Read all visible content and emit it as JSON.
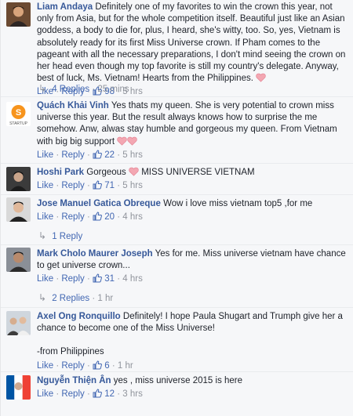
{
  "common": {
    "like": "Like",
    "reply": "Reply",
    "dot": "·"
  },
  "comments": [
    {
      "author": "Liam Andaya",
      "text": "Definitely one of my favorites to win the crown this year, not only from Asia, but for the whole competition itself. Beautiful just like an Asian goddess, a body to die for, plus, I heard, she's witty, too. So, yes, Vietnam is absolutely ready for its first Miss Universe crown. If Pham comes to the pageant with all the necessary preparations, I don't mind seeing the crown on her head even though my top favorite is still my country's delegate. Anyway, best of luck, Ms. Vietnam! Hearts from the Philippines.",
      "likes": "98",
      "time": "5 hrs",
      "replies": "4 Replies",
      "replies_time": "25 mins"
    },
    {
      "author": "Quách Khải Vinh",
      "text": "Yes thats my queen. She is very potential to crown miss universe this year. But the result always knows how to surprise the me somehow. Anw, alwas stay humble and gorgeous my queen. From Vietnam with big big support",
      "likes": "22",
      "time": "5 hrs",
      "avatar_label": "STARTUP"
    },
    {
      "author": "Hoshi Park",
      "text_before": "Gorgeous",
      "text_after": "MISS UNIVERSE VIETNAM",
      "likes": "71",
      "time": "5 hrs"
    },
    {
      "author": "Jose Manuel Gatica Obreque",
      "text": "Wow i love miss vietnam top5 ,for me",
      "likes": "20",
      "time": "4 hrs",
      "replies": "1 Reply"
    },
    {
      "author": "Mark Cholo Maurer Joseph",
      "text": "Yes for me. Miss universe vietnam have chance to get universe crown...",
      "likes": "31",
      "time": "4 hrs",
      "replies": "2 Replies",
      "replies_time": "1 hr"
    },
    {
      "author": "Axel Ong Ronquillo",
      "text": "Definitely! I hope Paula Shugart and Trumph give her a chance to become one of the Miss Universe!",
      "text2": "-from Philippines",
      "likes": "6",
      "time": "1 hr"
    },
    {
      "author": "Nguyễn Thiện Ân",
      "text": "yes , miss universe 2015 is here",
      "likes": "12",
      "time": "3 hrs"
    }
  ],
  "colors": {
    "author": "#365899",
    "link": "#4267b2",
    "meta": "#90949c",
    "heart": "#f3a7b2"
  },
  "icons": [
    "thumbs-up-icon",
    "heart-icon",
    "reply-arrow-icon"
  ]
}
